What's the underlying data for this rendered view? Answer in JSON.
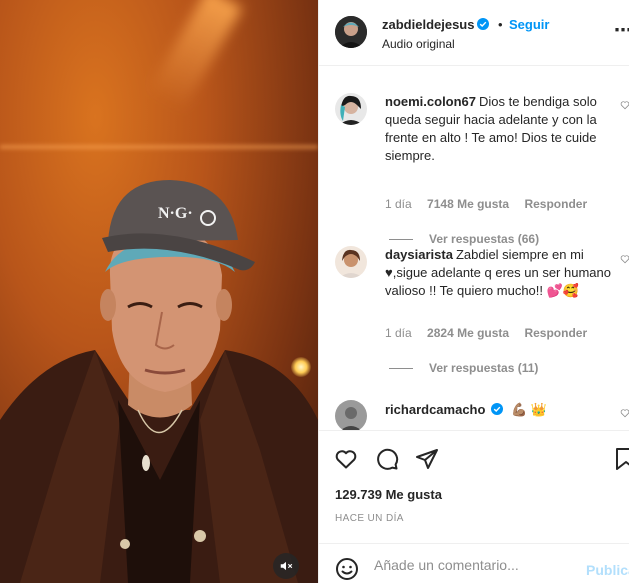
{
  "post": {
    "username": "zabdieldejesus",
    "follow_label": "Seguir",
    "audio_label": "Audio original",
    "separator": "•"
  },
  "comments": [
    {
      "username": "noemi.colon67",
      "text": "Dios te bendiga solo queda seguir hacia adelante y con la frente en alto ! Te amo! Dios te cuide siempre.",
      "age": "1 día",
      "likes": "7148 Me gusta",
      "reply_label": "Responder",
      "replies_label": "Ver respuestas (66)"
    },
    {
      "username": "daysiarista",
      "text": "Zabdiel siempre en mi ♥,sigue adelante q eres un ser humano valioso !! Te quiero mucho!! 💕🥰",
      "age": "1 día",
      "likes": "2824 Me gusta",
      "reply_label": "Responder",
      "replies_label": "Ver respuestas (11)"
    },
    {
      "username": "richardcamacho",
      "text": "💪🏽 👑"
    }
  ],
  "actions": {
    "like_icon": "heart-icon",
    "comment_icon": "comment-icon",
    "share_icon": "share-icon",
    "save_icon": "bookmark-icon"
  },
  "stats": {
    "likes": "129.739 Me gusta",
    "time_ago": "HACE UN DÍA"
  },
  "composer": {
    "placeholder": "Añade un comentario...",
    "publish_label": "Publicar",
    "emoji_icon": "emoji-icon"
  },
  "colors": {
    "accent": "#0095f6",
    "verified": "#0095f6",
    "muted": "#8e8e8e"
  }
}
